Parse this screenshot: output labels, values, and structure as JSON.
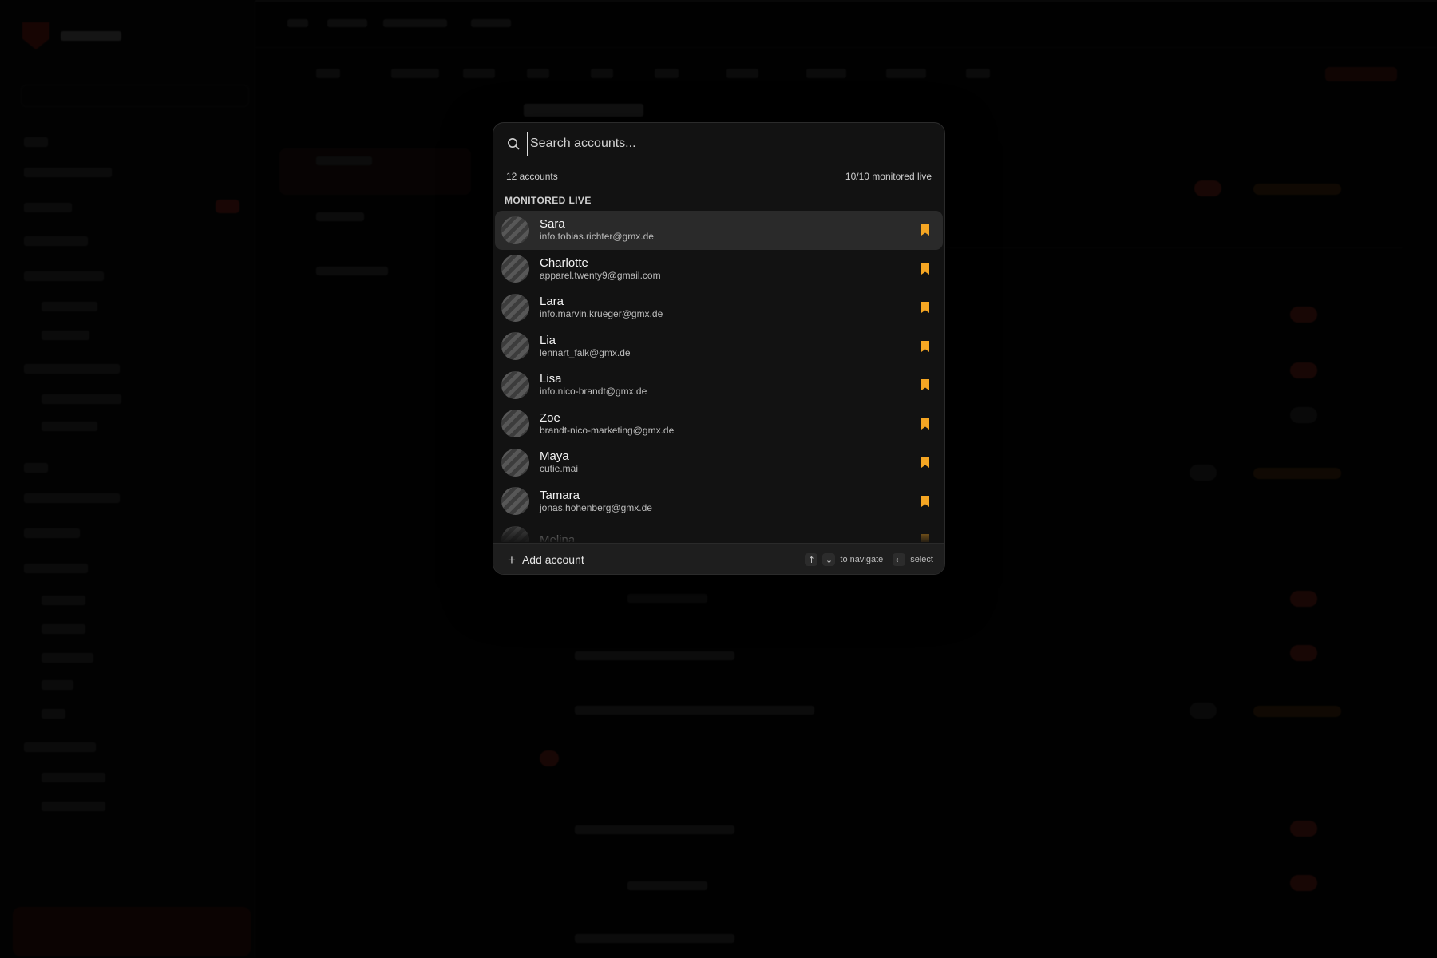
{
  "modal": {
    "search": {
      "placeholder": "Search accounts..."
    },
    "stats": {
      "count": "12 accounts",
      "monitored": "10/10 monitored live"
    },
    "section": "MONITORED LIVE",
    "accounts": [
      {
        "name": "Sara",
        "email": "info.tobias.richter@gmx.de",
        "bookmark_color": "#f5a623"
      },
      {
        "name": "Charlotte",
        "email": "apparel.twenty9@gmail.com",
        "bookmark_color": "#f5a623"
      },
      {
        "name": "Lara",
        "email": "info.marvin.krueger@gmx.de",
        "bookmark_color": "#f5a623"
      },
      {
        "name": "Lia",
        "email": "lennart_falk@gmx.de",
        "bookmark_color": "#f5a623"
      },
      {
        "name": "Lisa",
        "email": "info.nico-brandt@gmx.de",
        "bookmark_color": "#f5a623"
      },
      {
        "name": "Zoe",
        "email": "brandt-nico-marketing@gmx.de",
        "bookmark_color": "#f5a623"
      },
      {
        "name": "Maya",
        "email": "cutie.mai",
        "bookmark_color": "#f5a623"
      },
      {
        "name": "Tamara",
        "email": "jonas.hohenberg@gmx.de",
        "bookmark_color": "#f5a623"
      },
      {
        "name": "Melina",
        "email": "",
        "bookmark_color": "#f5a623"
      }
    ],
    "footer": {
      "add_label": "Add account",
      "nav_up": "↑",
      "nav_down": "↓",
      "nav_label": "to navigate",
      "enter_key": "↵",
      "select_label": "select"
    }
  },
  "colors": {
    "accent_orange": "#f5a623",
    "brand_red": "#a7261a"
  }
}
